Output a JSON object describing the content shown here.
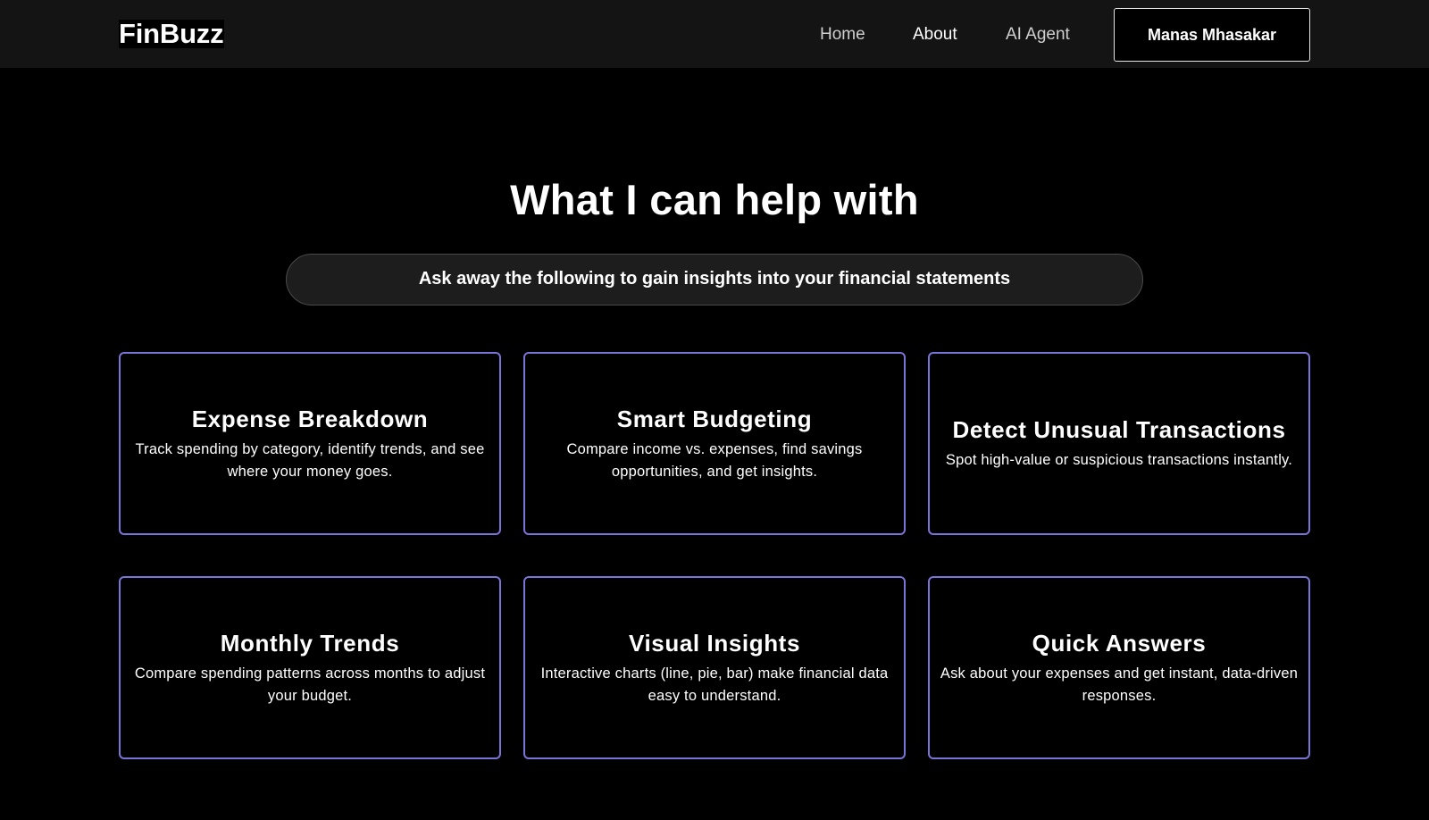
{
  "header": {
    "brand": "FinBuzz",
    "nav": [
      {
        "label": "Home",
        "active": false
      },
      {
        "label": "About",
        "active": true
      },
      {
        "label": "AI Agent",
        "active": false
      }
    ],
    "user_button": "Manas Mhasakar"
  },
  "hero": {
    "title": "What I can help with",
    "subtitle": "Ask away the following to gain insights into your financial statements"
  },
  "features": [
    {
      "title": "Expense Breakdown",
      "description": "Track spending by category, identify trends, and see where your money goes."
    },
    {
      "title": "Smart Budgeting",
      "description": "Compare income vs. expenses, find savings opportunities, and get insights."
    },
    {
      "title": "Detect Unusual Transactions",
      "description": "Spot high-value or suspicious transactions instantly."
    },
    {
      "title": "Monthly Trends",
      "description": "Compare spending patterns across months to adjust your budget."
    },
    {
      "title": "Visual Insights",
      "description": "Interactive charts (line, pie, bar) make financial data easy to understand."
    },
    {
      "title": "Quick Answers",
      "description": "Ask about your expenses and get instant, data-driven responses."
    }
  ],
  "colors": {
    "background": "#000000",
    "navbar": "#141414",
    "card_border": "#7b74d8",
    "pill_background": "#1d1d1d"
  }
}
